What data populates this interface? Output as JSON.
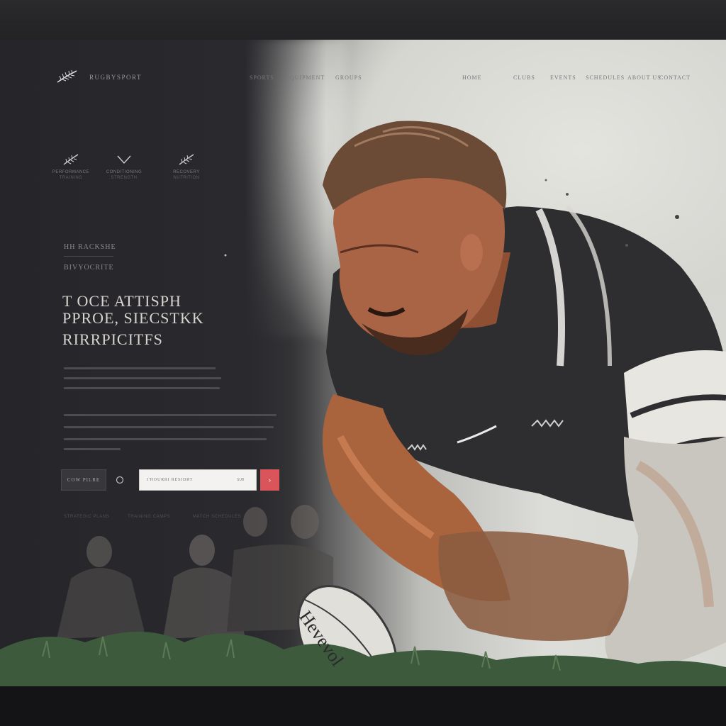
{
  "brand": {
    "name": "RUGBYSPORT"
  },
  "nav": {
    "left": [
      "SPORTS",
      "EQUIPMENT",
      "GROUPS"
    ],
    "right": [
      "HOME",
      "CLUBS",
      "EVENTS",
      "SCHEDULES",
      "ABOUT US",
      "CONTACT"
    ]
  },
  "features": [
    {
      "label": "PERFORMANCE",
      "sub": "TRAINING"
    },
    {
      "label": "CONDITIONING",
      "sub": "STRENGTH"
    },
    {
      "label": "RECOVERY",
      "sub": "NUTRITION"
    }
  ],
  "eyebrow": {
    "line1": "HH RACKSHE",
    "line2": "BIVYOCRITE"
  },
  "headline": {
    "line1": "T OCE  ATTISPH",
    "line2": "PPROE, SIECSTKK",
    "line3": "RIRRPICITFS"
  },
  "cta": {
    "button_label": "COW PILRE",
    "email_placeholder": "I'HOURRI RESIDRT",
    "email_hint": "SUB",
    "submit_label": "›"
  },
  "footer": [
    "STRATEGIC PLANS",
    "TRAINING CAMPS",
    "MATCH SCHEDULES"
  ],
  "ball": {
    "text": "Hevevol"
  },
  "colors": {
    "accent": "#d9555a",
    "background_dark": "#26262a",
    "background_light": "#dcdcd8",
    "headline": "#d8d4cf"
  },
  "icons": {
    "logo": "fern-icon",
    "feature1": "fern-icon",
    "feature2": "chevron-down-icon",
    "feature3": "fern-icon",
    "cta": "circle-icon"
  }
}
